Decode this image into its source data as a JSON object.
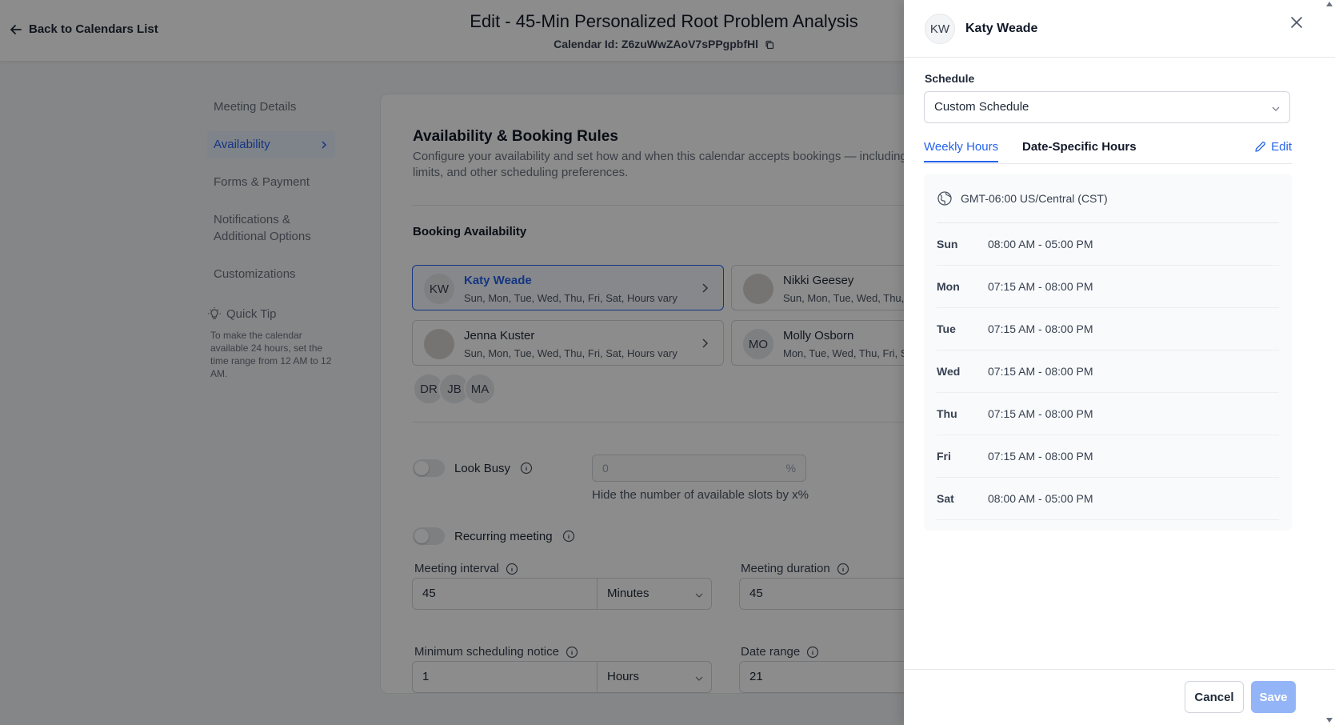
{
  "header": {
    "back_label": "Back to Calendars List",
    "title": "Edit - 45-Min Personalized Root Problem Analysis",
    "calendar_id_label": "Calendar Id:",
    "calendar_id": "Z6zuWwZAoV7sPPgpbfHl"
  },
  "sidebar": {
    "items": [
      {
        "label": "Meeting Details"
      },
      {
        "label": "Availability"
      },
      {
        "label": "Forms & Payment"
      },
      {
        "label": "Notifications & Additional Options"
      },
      {
        "label": "Customizations"
      }
    ],
    "quick_tip_title": "Quick Tip",
    "quick_tip_text": "To make the calendar available 24 hours, set the time range from 12 AM to 12 AM."
  },
  "main": {
    "section_title": "Availability & Booking Rules",
    "section_desc": "Configure your availability and set how and when this calendar accepts bookings — including m limits, and other scheduling preferences.",
    "booking_title": "Booking Availability",
    "members": [
      {
        "initials": "KW",
        "name": "Katy Weade",
        "days": "Sun, Mon, Tue, Wed, Thu, Fri, Sat, Hours vary"
      },
      {
        "initials": "",
        "name": "Nikki Geesey",
        "days": "Sun, Mon, Tue, Wed, Thu, Fr"
      },
      {
        "initials": "",
        "name": "Jenna Kuster",
        "days": "Sun, Mon, Tue, Wed, Thu, Fri, Sat, Hours vary"
      },
      {
        "initials": "MO",
        "name": "Molly Osborn",
        "days": "Mon, Tue, Wed, Thu, Fri, Sat"
      }
    ],
    "extra_members": [
      "DR",
      "JB",
      "MA"
    ],
    "look_busy_label": "Look Busy",
    "look_busy_value": "0",
    "look_busy_unit": "%",
    "look_busy_help": "Hide the number of available slots by x%",
    "recurring_label": "Recurring meeting",
    "interval_label": "Meeting interval",
    "interval_value": "45",
    "interval_unit": "Minutes",
    "duration_label": "Meeting duration",
    "duration_value": "45",
    "notice_label": "Minimum scheduling notice",
    "notice_value": "1",
    "notice_unit": "Hours",
    "date_range_label": "Date range",
    "date_range_value": "21"
  },
  "drawer": {
    "initials": "KW",
    "name": "Katy Weade",
    "schedule_label": "Schedule",
    "schedule_value": "Custom Schedule",
    "tab_weekly": "Weekly Hours",
    "tab_date": "Date-Specific Hours",
    "edit_label": "Edit",
    "timezone": "GMT-06:00 US/Central (CST)",
    "days": [
      {
        "day": "Sun",
        "hours": "08:00 AM - 05:00 PM"
      },
      {
        "day": "Mon",
        "hours": "07:15 AM - 08:00 PM"
      },
      {
        "day": "Tue",
        "hours": "07:15 AM - 08:00 PM"
      },
      {
        "day": "Wed",
        "hours": "07:15 AM - 08:00 PM"
      },
      {
        "day": "Thu",
        "hours": "07:15 AM - 08:00 PM"
      },
      {
        "day": "Fri",
        "hours": "07:15 AM - 08:00 PM"
      },
      {
        "day": "Sat",
        "hours": "08:00 AM - 05:00 PM"
      }
    ],
    "cancel_label": "Cancel",
    "save_label": "Save"
  },
  "colors": {
    "accent": "#2563eb",
    "save_disabled": "#93b4f6",
    "overlay": "#000000"
  }
}
